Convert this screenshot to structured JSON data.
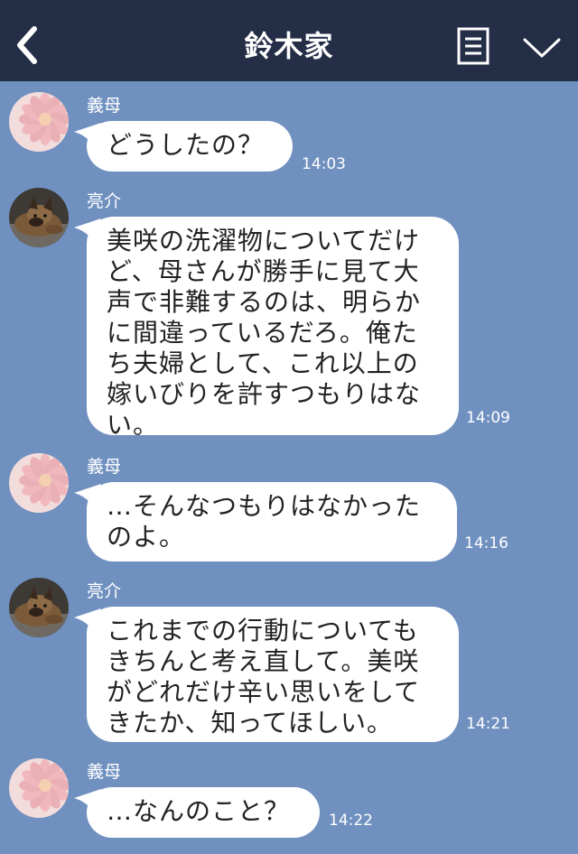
{
  "header": {
    "title": "鈴木家",
    "back_icon": "chevron-left-icon",
    "menu_icon": "list-icon",
    "more_icon": "chevron-down-icon",
    "background": "#242e47"
  },
  "chat": {
    "background": "#7090c0",
    "messages": [
      {
        "sender": "義母",
        "avatar": "flower-avatar",
        "text": "どうしたの？",
        "time": "14:03"
      },
      {
        "sender": "亮介",
        "avatar": "dog-avatar",
        "text": "美咲の洗濯物についてだけ\nど、母さんが勝手に見て大\n声で非難するのは、明らか\nに間違っているだろ。俺た\nち夫婦として、これ以上の\n嫁いびりを許すつもりはな\nい。",
        "time": "14:09"
      },
      {
        "sender": "義母",
        "avatar": "flower-avatar",
        "text": "…そんなつもりはなかった\nのよ。",
        "time": "14:16"
      },
      {
        "sender": "亮介",
        "avatar": "dog-avatar",
        "text": "これまでの行動についても\nきちんと考え直して。美咲\nがどれだけ辛い思いをして\nきたか、知ってほしい。",
        "time": "14:21"
      },
      {
        "sender": "義母",
        "avatar": "flower-avatar",
        "text": "…なんのこと？",
        "time": "14:22"
      }
    ]
  }
}
